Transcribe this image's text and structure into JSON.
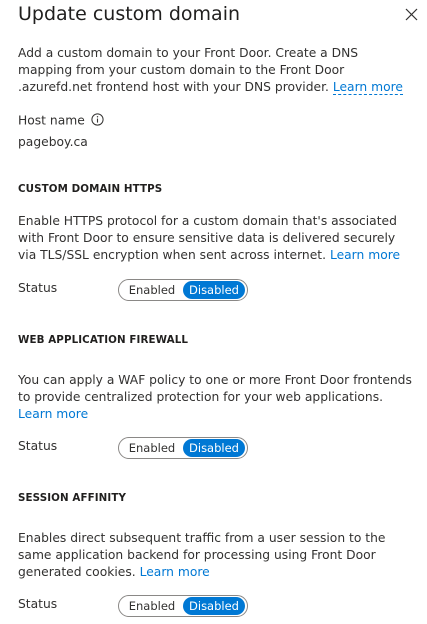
{
  "panel": {
    "title": "Update custom domain",
    "close_icon": "close-icon",
    "intro_text": "Add a custom domain to your Front Door. Create a DNS mapping from your custom domain to the Front Door .azurefd.net frontend host with your DNS provider.",
    "intro_link": "Learn more"
  },
  "host": {
    "label": "Host name",
    "info_icon": "info-icon",
    "value": "pageboy.ca"
  },
  "sections": [
    {
      "heading": "CUSTOM DOMAIN HTTPS",
      "description": "Enable HTTPS protocol for a custom domain that's associated with Front Door to ensure sensitive data is delivered securely via TLS/SSL encryption when sent across internet.",
      "link": "Learn more",
      "status_label": "Status",
      "options": [
        "Enabled",
        "Disabled"
      ],
      "selected": "Disabled"
    },
    {
      "heading": "WEB APPLICATION FIREWALL",
      "description": "You can apply a WAF policy to one or more Front Door frontends to provide centralized protection for your web applications.",
      "link": "Learn more",
      "status_label": "Status",
      "options": [
        "Enabled",
        "Disabled"
      ],
      "selected": "Disabled"
    },
    {
      "heading": "SESSION AFFINITY",
      "description": "Enables direct subsequent traffic from a user session to the same application backend for processing using Front Door generated cookies.",
      "link": "Learn more",
      "status_label": "Status",
      "options": [
        "Enabled",
        "Disabled"
      ],
      "selected": "Disabled"
    }
  ],
  "colors": {
    "accent": "#0078d4",
    "text": "#323130",
    "heading": "#201f1e",
    "toggle_border": "#8a8886"
  }
}
